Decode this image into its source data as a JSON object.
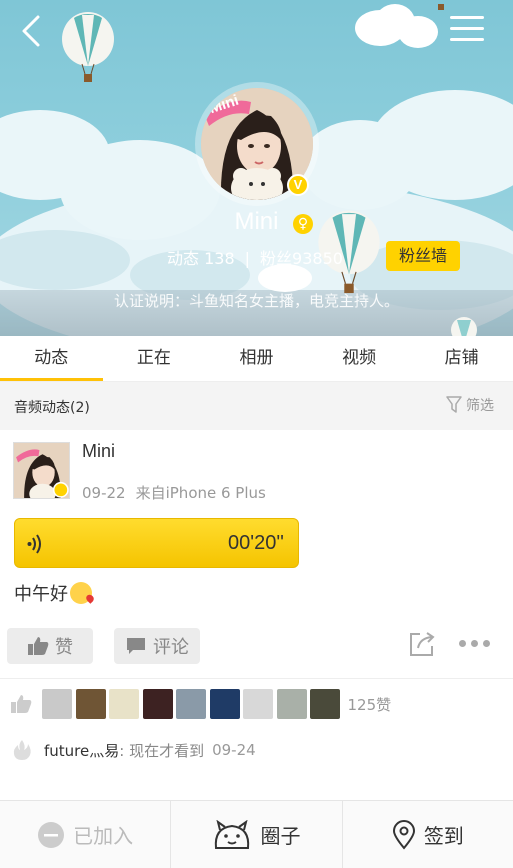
{
  "profile": {
    "name": "Mini",
    "stats_posts": "动态 138",
    "stats_sep": "|",
    "stats_fans": "粉丝93850",
    "fan_wall_label": "粉丝墙",
    "verification": "认证说明：斗鱼知名女主播，电竞主持人。",
    "avatar_caption": "Mini",
    "badge": "V"
  },
  "tabs": [
    "动态",
    "正在",
    "相册",
    "视频",
    "店铺"
  ],
  "active_tab": 0,
  "section": {
    "title": "音频动态(2)",
    "filter_label": "筛选"
  },
  "post": {
    "author": "Mini",
    "date": "09-22",
    "source": "来自iPhone 6 Plus",
    "audio_duration": "00'20''",
    "text": "中午好",
    "like_label": "赞",
    "comment_label": "评论"
  },
  "likes": {
    "count_label": "125赞",
    "avatar_colors": [
      "#c9c9c9",
      "#6f5535",
      "#e8e2c8",
      "#3d2222",
      "#8a9aa8",
      "#1f3b66",
      "#d8d8d8",
      "#a9b0a8",
      "#4a4a3a"
    ]
  },
  "comment": {
    "user": "future灬易",
    "text": ": 现在才看到",
    "time": "09-24"
  },
  "bottom_bar": {
    "joined_label": "已加入",
    "circle_label": "圈子",
    "checkin_label": "签到"
  },
  "colors": {
    "accent": "#ffd200",
    "tab_underline": "#ffc107"
  }
}
